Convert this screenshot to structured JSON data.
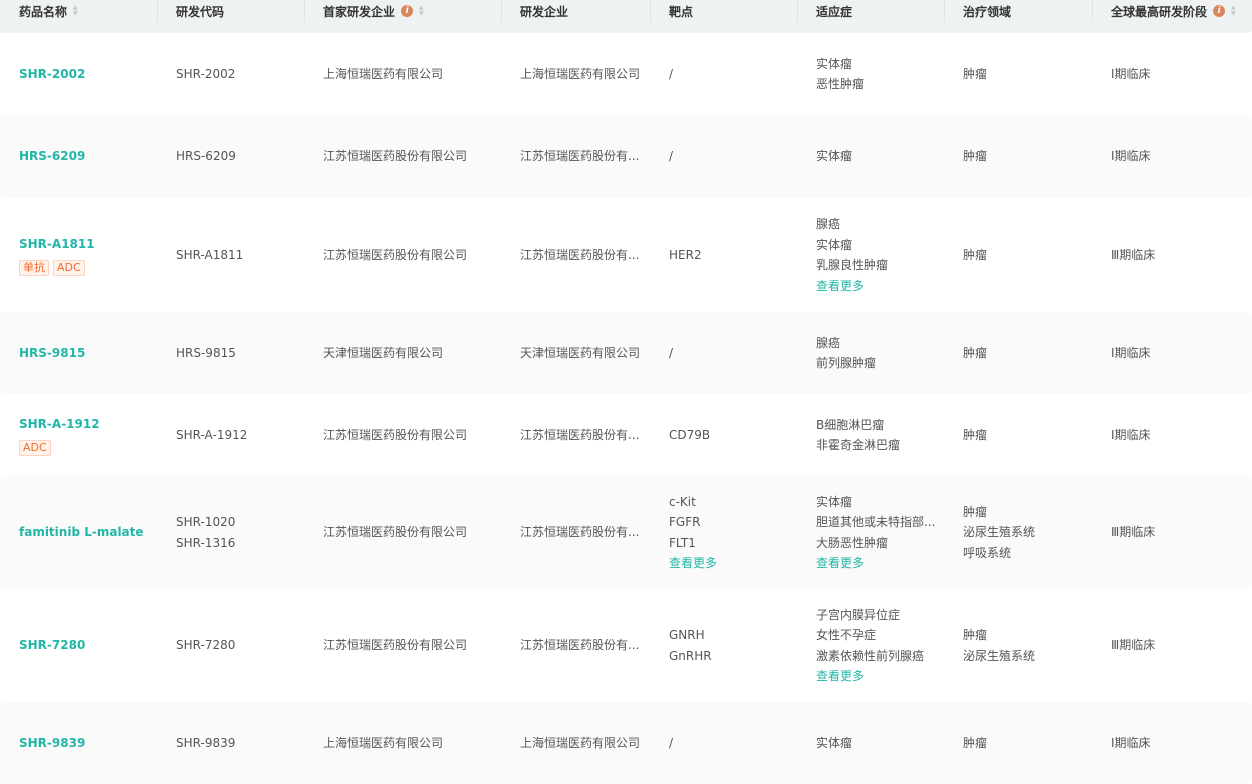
{
  "headers": [
    "药品名称",
    "研发代码",
    "首家研发企业",
    "研发企业",
    "靶点",
    "适应症",
    "治疗领域",
    "全球最高研发阶段"
  ],
  "more_label": "查看更多",
  "rows": [
    {
      "name": "SHR-2002",
      "tags": [],
      "codes": [
        "SHR-2002"
      ],
      "first": "上海恒瑞医药有限公司",
      "dev": "上海恒瑞医药有限公司",
      "targets": [
        "/"
      ],
      "targets_more": false,
      "ind": [
        "实体瘤",
        "恶性肿瘤"
      ],
      "ind_more": false,
      "areas": [
        "肿瘤"
      ],
      "phase": "Ⅰ期临床",
      "h": 82
    },
    {
      "name": "HRS-6209",
      "tags": [],
      "codes": [
        "HRS-6209"
      ],
      "first": "江苏恒瑞医药股份有限公司",
      "dev": "江苏恒瑞医药股份有...",
      "targets": [
        "/"
      ],
      "targets_more": false,
      "ind": [
        "实体瘤"
      ],
      "ind_more": false,
      "areas": [
        "肿瘤"
      ],
      "phase": "Ⅰ期临床",
      "h": 83
    },
    {
      "name": "SHR-A1811",
      "tags": [
        "单抗",
        "ADC"
      ],
      "codes": [
        "SHR-A1811"
      ],
      "first": "江苏恒瑞医药股份有限公司",
      "dev": "江苏恒瑞医药股份有...",
      "targets": [
        "HER2"
      ],
      "targets_more": false,
      "ind": [
        "腺癌",
        "实体瘤",
        "乳腺良性肿瘤"
      ],
      "ind_more": true,
      "areas": [
        "肿瘤"
      ],
      "phase": "Ⅲ期临床",
      "h": 114
    },
    {
      "name": "HRS-9815",
      "tags": [],
      "codes": [
        "HRS-9815"
      ],
      "first": "天津恒瑞医药有限公司",
      "dev": "天津恒瑞医药有限公司",
      "targets": [
        "/"
      ],
      "targets_more": false,
      "ind": [
        "腺癌",
        "前列腺肿瘤"
      ],
      "ind_more": false,
      "areas": [
        "肿瘤"
      ],
      "phase": "Ⅰ期临床",
      "h": 82
    },
    {
      "name": "SHR-A-1912",
      "tags": [
        "ADC"
      ],
      "codes": [
        "SHR-A-1912"
      ],
      "first": "江苏恒瑞医药股份有限公司",
      "dev": "江苏恒瑞医药股份有...",
      "targets": [
        "CD79B"
      ],
      "targets_more": false,
      "ind": [
        "B细胞淋巴瘤",
        "非霍奇金淋巴瘤"
      ],
      "ind_more": false,
      "areas": [
        "肿瘤"
      ],
      "phase": "Ⅰ期临床",
      "h": 82
    },
    {
      "name": "famitinib L-malate",
      "tags": [],
      "codes": [
        "SHR-1020",
        "SHR-1316"
      ],
      "first": "江苏恒瑞医药股份有限公司",
      "dev": "江苏恒瑞医药股份有...",
      "targets": [
        "c-Kit",
        "FGFR",
        "FLT1"
      ],
      "targets_more": true,
      "ind": [
        "实体瘤",
        "胆道其他或未特指部...",
        "大肠恶性肿瘤"
      ],
      "ind_more": true,
      "areas": [
        "肿瘤",
        "泌尿生殖系统",
        "呼吸系统"
      ],
      "phase": "Ⅲ期临床",
      "h": 113
    },
    {
      "name": "SHR-7280",
      "tags": [],
      "codes": [
        "SHR-7280"
      ],
      "first": "江苏恒瑞医药股份有限公司",
      "dev": "江苏恒瑞医药股份有...",
      "targets": [
        "GNRH",
        "GnRHR"
      ],
      "targets_more": false,
      "ind": [
        "子宫内膜异位症",
        "女性不孕症",
        "激素依赖性前列腺癌"
      ],
      "ind_more": true,
      "areas": [
        "肿瘤",
        "泌尿生殖系统"
      ],
      "phase": "Ⅲ期临床",
      "h": 113
    },
    {
      "name": "SHR-9839",
      "tags": [],
      "codes": [
        "SHR-9839"
      ],
      "first": "上海恒瑞医药有限公司",
      "dev": "上海恒瑞医药有限公司",
      "targets": [
        "/"
      ],
      "targets_more": false,
      "ind": [
        "实体瘤"
      ],
      "ind_more": false,
      "areas": [
        "肿瘤"
      ],
      "phase": "Ⅰ期临床",
      "h": 82
    }
  ]
}
